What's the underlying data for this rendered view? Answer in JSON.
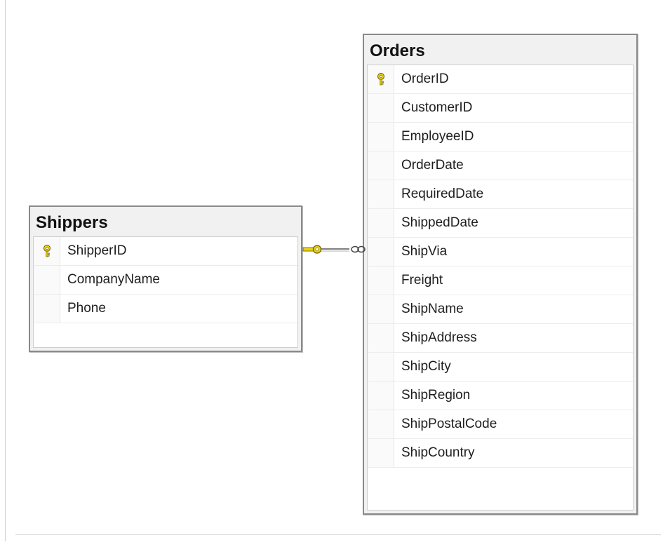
{
  "diagram": {
    "tables": [
      {
        "title": "Shippers",
        "columns": [
          {
            "name": "ShipperID",
            "primary_key": true
          },
          {
            "name": "CompanyName",
            "primary_key": false
          },
          {
            "name": "Phone",
            "primary_key": false
          }
        ]
      },
      {
        "title": "Orders",
        "columns": [
          {
            "name": "OrderID",
            "primary_key": true
          },
          {
            "name": "CustomerID",
            "primary_key": false
          },
          {
            "name": "EmployeeID",
            "primary_key": false
          },
          {
            "name": "OrderDate",
            "primary_key": false
          },
          {
            "name": "RequiredDate",
            "primary_key": false
          },
          {
            "name": "ShippedDate",
            "primary_key": false
          },
          {
            "name": "ShipVia",
            "primary_key": false
          },
          {
            "name": "Freight",
            "primary_key": false
          },
          {
            "name": "ShipName",
            "primary_key": false
          },
          {
            "name": "ShipAddress",
            "primary_key": false
          },
          {
            "name": "ShipCity",
            "primary_key": false
          },
          {
            "name": "ShipRegion",
            "primary_key": false
          },
          {
            "name": "ShipPostalCode",
            "primary_key": false
          },
          {
            "name": "ShipCountry",
            "primary_key": false
          }
        ]
      }
    ],
    "relationship": {
      "from": "Shippers",
      "to": "Orders",
      "from_end": "one",
      "to_end": "many"
    },
    "colors": {
      "key_yellow": "#e8d21a",
      "border": "#8a8a8a"
    }
  }
}
